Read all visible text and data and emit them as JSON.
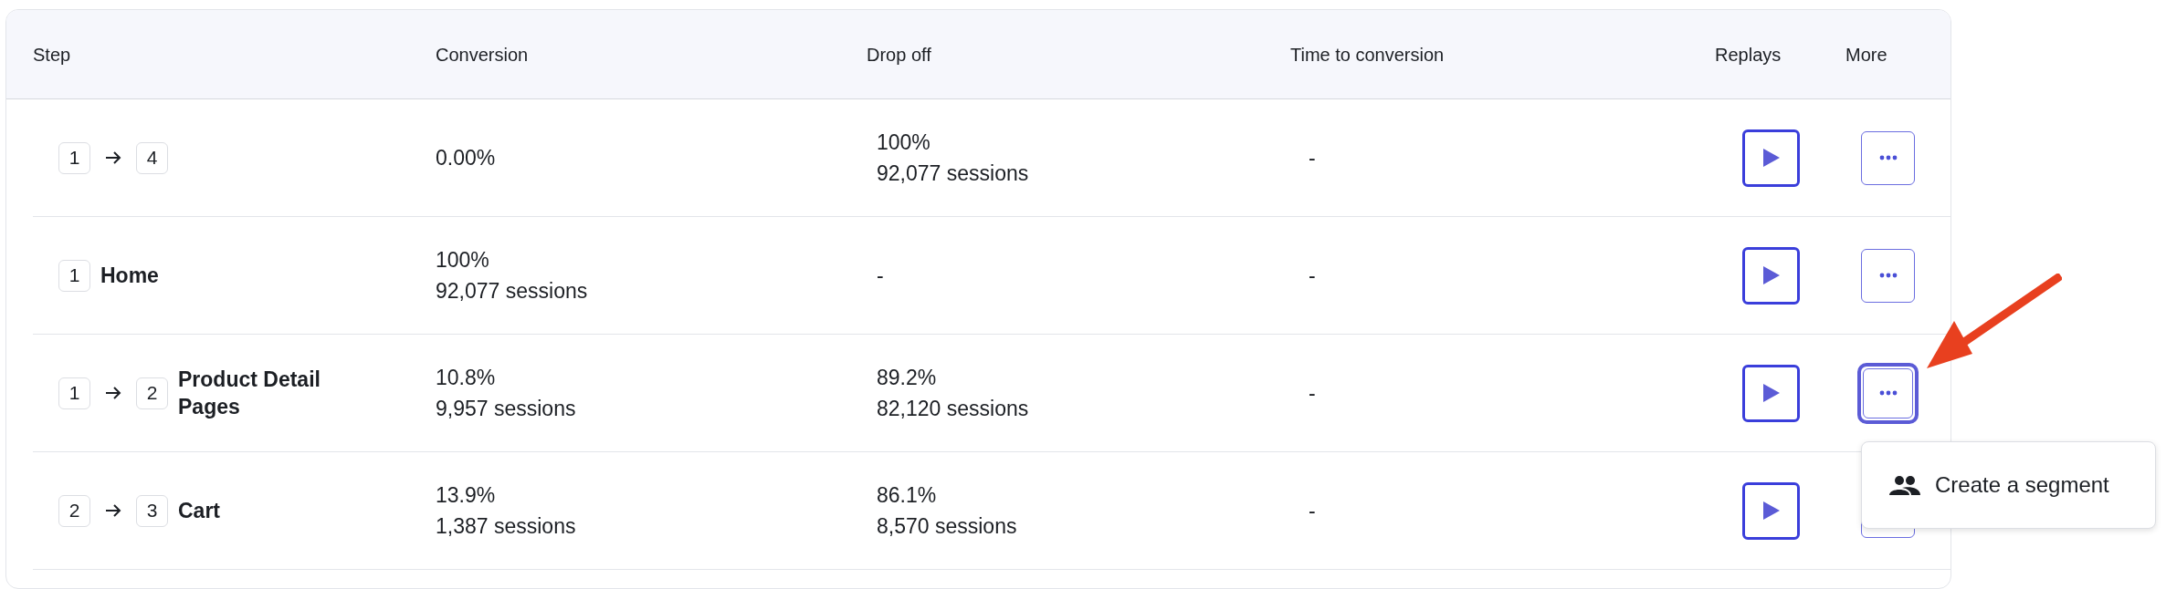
{
  "table": {
    "columns": [
      "Step",
      "Conversion",
      "Drop off",
      "Time to conversion",
      "Replays",
      "More"
    ],
    "rows": [
      {
        "step": {
          "badges": [
            "1",
            "4"
          ]
        },
        "conversion": [
          "0.00%"
        ],
        "drop_off": [
          "100%",
          "92,077 sessions"
        ],
        "time": "-",
        "more_selected": false
      },
      {
        "step": {
          "badges": [
            "1"
          ],
          "name": "Home"
        },
        "conversion": [
          "100%",
          "92,077 sessions"
        ],
        "drop_off": [
          "-"
        ],
        "time": "-",
        "more_selected": false
      },
      {
        "step": {
          "badges": [
            "1",
            "2"
          ],
          "name": "Product Detail Pages"
        },
        "conversion": [
          "10.8%",
          "9,957 sessions"
        ],
        "drop_off": [
          "89.2%",
          "82,120 sessions"
        ],
        "time": "-",
        "more_selected": true
      },
      {
        "step": {
          "badges": [
            "2",
            "3"
          ],
          "name": "Cart"
        },
        "conversion": [
          "13.9%",
          "1,387 sessions"
        ],
        "drop_off": [
          "86.1%",
          "8,570 sessions"
        ],
        "time": "-",
        "more_selected": false
      }
    ]
  },
  "menu": {
    "items": [
      {
        "label": "Create a segment"
      }
    ]
  }
}
